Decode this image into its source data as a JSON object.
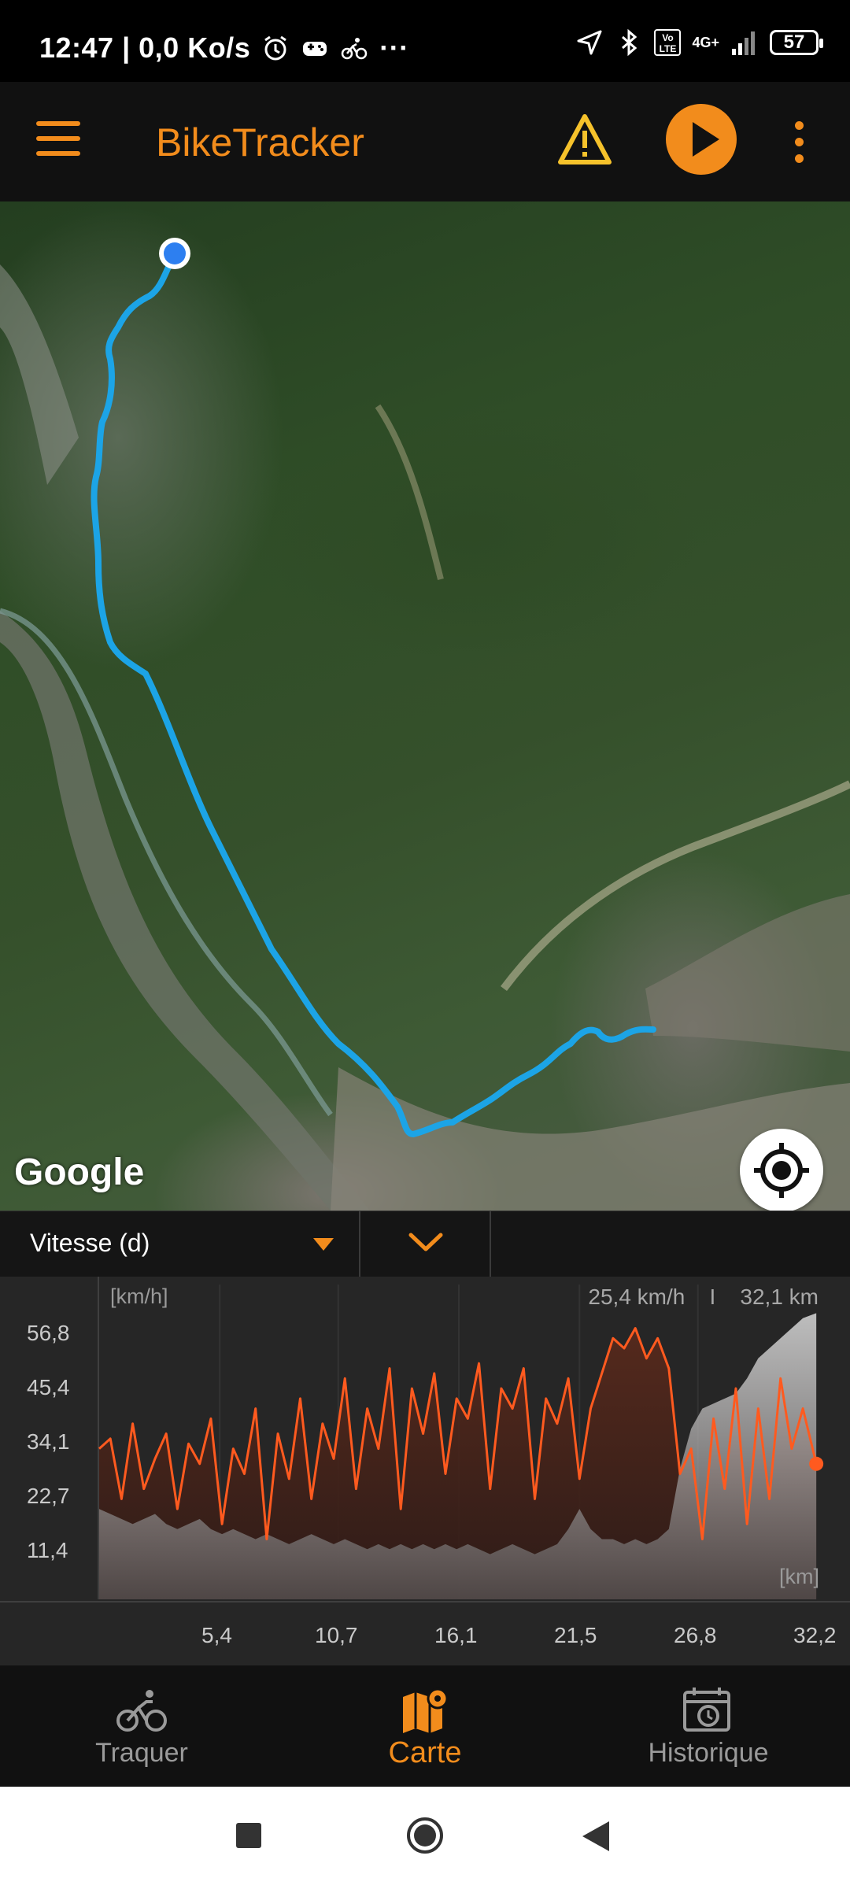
{
  "status_bar": {
    "time_info": "12:47 | 0,0 Ko/s",
    "more_indicator": "···",
    "network": "4G+",
    "volte": "Vo LTE",
    "battery": "57"
  },
  "app_bar": {
    "title": "BikeTracker",
    "accent_color": "#f28c1c"
  },
  "map": {
    "attribution": "Google",
    "track_color": "#1ca4e6",
    "zoom_in": "+",
    "zoom_out": "−"
  },
  "chart_selector": {
    "metric": "Vitesse (d)"
  },
  "chart": {
    "y_unit": "[km/h]",
    "x_unit": "[km]",
    "summary_speed": "25,4 km/h",
    "summary_sep": "I",
    "summary_distance": "32,1 km"
  },
  "chart_data": {
    "type": "area",
    "title": "",
    "ylabel": "[km/h]",
    "xlabel": "[km]",
    "y_ticks": [
      "56,8",
      "45,4",
      "34,1",
      "22,7",
      "11,4"
    ],
    "x_ticks": [
      "5,4",
      "10,7",
      "16,1",
      "21,5",
      "26,8",
      "32,2"
    ],
    "ylim": [
      0,
      58
    ],
    "xlim": [
      0,
      32.2
    ],
    "series": [
      {
        "color": "#ff5a1f",
        "x": [
          0,
          0.5,
          1,
          1.5,
          2,
          2.5,
          3,
          3.5,
          4,
          4.5,
          5,
          5.5,
          6,
          6.5,
          7,
          7.5,
          8,
          8.5,
          9,
          9.5,
          10,
          10.5,
          11,
          11.5,
          12,
          12.5,
          13,
          13.5,
          14,
          14.5,
          15,
          15.5,
          16,
          16.5,
          17,
          17.5,
          18,
          18.5,
          19,
          19.5,
          20,
          20.5,
          21,
          21.5,
          22,
          22.5,
          23,
          23.5,
          24,
          24.5,
          25,
          25.5,
          26,
          26.5,
          27,
          27.5,
          28,
          28.5,
          29,
          29.5,
          30,
          30.5,
          31,
          31.5,
          32.1
        ],
        "values": [
          30,
          32,
          20,
          35,
          22,
          28,
          33,
          18,
          31,
          27,
          36,
          15,
          30,
          25,
          38,
          12,
          33,
          24,
          40,
          20,
          35,
          28,
          44,
          22,
          38,
          30,
          46,
          18,
          42,
          33,
          45,
          25,
          40,
          36,
          47,
          22,
          42,
          38,
          46,
          20,
          40,
          35,
          44,
          24,
          38,
          45,
          52,
          50,
          54,
          48,
          52,
          46,
          25,
          30,
          12,
          36,
          22,
          42,
          15,
          38,
          20,
          44,
          30,
          38,
          27
        ],
        "markers": "none"
      }
    ],
    "background_profile": {
      "name": "",
      "values": [
        18,
        17,
        16,
        15,
        16,
        17,
        15,
        14,
        15,
        16,
        14,
        13,
        14,
        13,
        12,
        13,
        12,
        11,
        12,
        13,
        12,
        11,
        12,
        11,
        10,
        11,
        10,
        11,
        10,
        11,
        10,
        11,
        10,
        11,
        10,
        9,
        10,
        11,
        10,
        9,
        10,
        11,
        14,
        18,
        14,
        12,
        12,
        11,
        12,
        11,
        12,
        14,
        26,
        34,
        38,
        39,
        40,
        41,
        44,
        48,
        50,
        52,
        54,
        56,
        57
      ]
    }
  },
  "bottom_nav": [
    {
      "label": "Traquer"
    },
    {
      "label": "Carte"
    },
    {
      "label": "Historique"
    }
  ]
}
